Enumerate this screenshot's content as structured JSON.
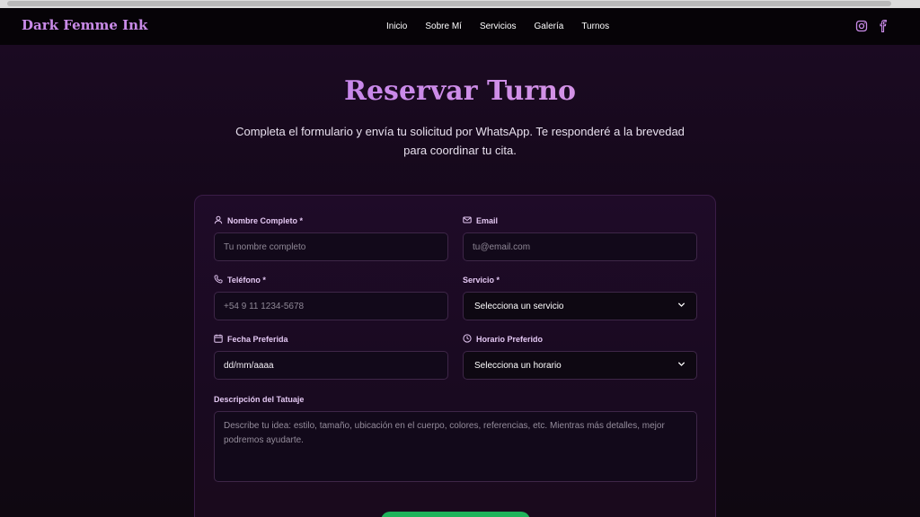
{
  "brand": "Dark Femme Ink",
  "nav": [
    {
      "label": "Inicio"
    },
    {
      "label": "Sobre Mí"
    },
    {
      "label": "Servicios"
    },
    {
      "label": "Galería"
    },
    {
      "label": "Turnos"
    }
  ],
  "social": [
    {
      "icon": "instagram-icon"
    },
    {
      "icon": "facebook-icon"
    }
  ],
  "page": {
    "title": "Reservar Turno",
    "subtitle": "Completa el formulario y envía tu solicitud por WhatsApp. Te responderé a la brevedad para coordinar tu cita."
  },
  "form": {
    "name": {
      "label": "Nombre Completo *",
      "placeholder": "Tu nombre completo",
      "icon": "user-icon"
    },
    "email": {
      "label": "Email",
      "placeholder": "tu@email.com",
      "icon": "mail-icon"
    },
    "phone": {
      "label": "Teléfono *",
      "placeholder": "+54 9 11 1234-5678",
      "icon": "phone-icon"
    },
    "service": {
      "label": "Servicio *",
      "value": "Selecciona un servicio"
    },
    "date": {
      "label": "Fecha Preferida",
      "value": "dd/mm/aaaa",
      "icon": "calendar-icon"
    },
    "time": {
      "label": "Horario Preferido",
      "value": "Selecciona un horario",
      "icon": "clock-icon"
    },
    "description": {
      "label": "Descripción del Tatuaje",
      "placeholder": "Describe tu idea: estilo, tamaño, ubicación en el cuerpo, colores, referencias, etc. Mientras más detalles, mejor podremos ayudarte."
    }
  },
  "colors": {
    "accent": "#c98be8",
    "submit": "#1fb35a",
    "background": "#120816"
  }
}
